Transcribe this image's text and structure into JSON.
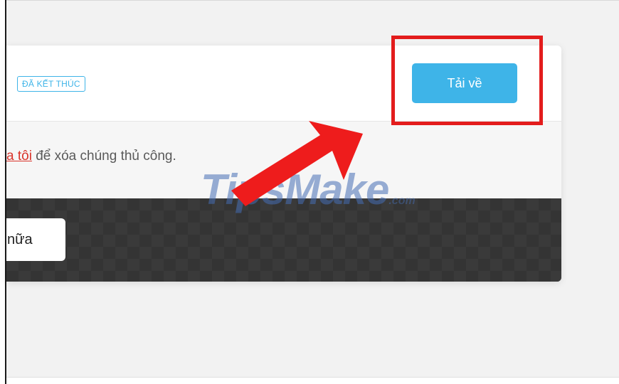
{
  "card": {
    "status_badge": "ĐÃ KẾT THÚC",
    "download_button": "Tải về"
  },
  "info": {
    "link_text": "a tôi",
    "text": " để xóa chúng thủ công."
  },
  "panel": {
    "more_button": "nữa"
  },
  "watermark": {
    "main": "TipsMake",
    "suffix": ".com"
  },
  "colors": {
    "accent": "#3eb4e8",
    "link": "#d9342b",
    "highlight": "#e31c1c",
    "panel": "#343434"
  },
  "icons": {
    "annotation_arrow": "arrow-icon"
  }
}
